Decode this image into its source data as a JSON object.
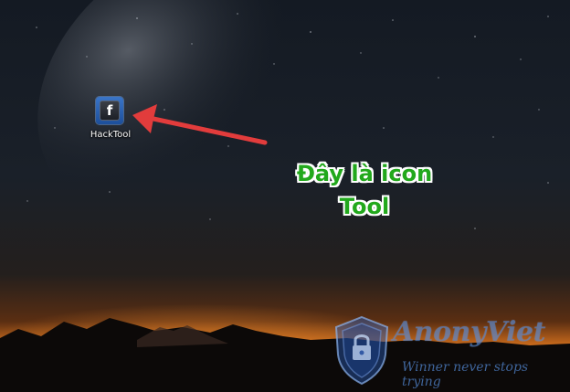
{
  "desktop": {
    "icons": [
      {
        "label": "HackTool",
        "glyph": "f",
        "icon_name": "facebook-icon"
      }
    ]
  },
  "annotation": {
    "line1": "Đây là icon",
    "line2": "Tool",
    "text_color": "#22a81c",
    "arrow_color": "#e23c3c"
  },
  "watermark": {
    "brand": "AnonyViet",
    "tagline": "Winner never stops trying",
    "color": "#3c78d2"
  }
}
